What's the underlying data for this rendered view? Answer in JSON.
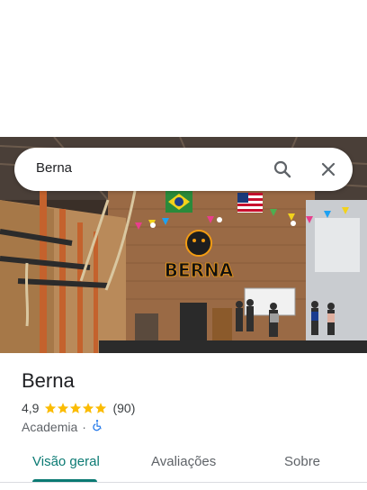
{
  "search": {
    "query": "Berna"
  },
  "place": {
    "name": "Berna",
    "rating": "4,9",
    "review_count": "(90)",
    "stars_filled": 5,
    "category": "Academia",
    "separator": "·",
    "photo_sign_text": "BERNA"
  },
  "tabs": [
    {
      "label": "Visão geral",
      "active": true
    },
    {
      "label": "Avaliações",
      "active": false
    },
    {
      "label": "Sobre",
      "active": false
    }
  ],
  "icons": {
    "search": "search-icon",
    "close": "close-icon",
    "star": "star-icon",
    "accessibility": "wheelchair-icon"
  },
  "colors": {
    "accent": "#0b7a73",
    "star": "#fbbc04",
    "accessibility": "#1a73e8"
  }
}
